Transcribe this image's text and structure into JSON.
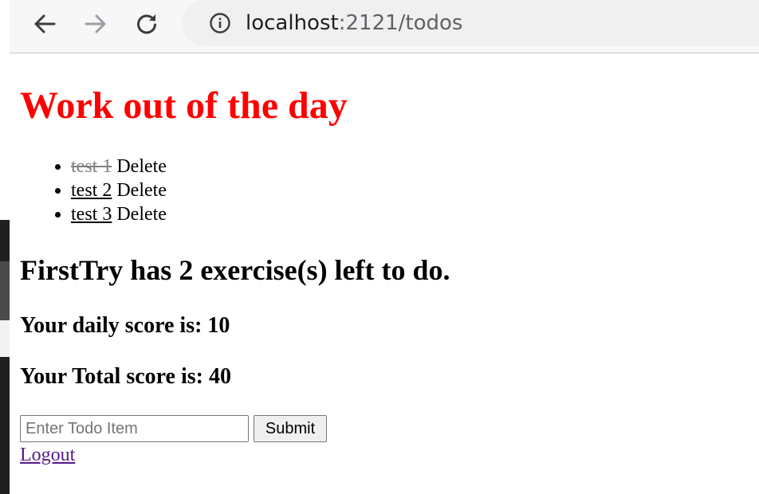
{
  "browser": {
    "url_host": "localhost",
    "url_path": ":2121/todos",
    "icons": {
      "back": "arrow-left-icon",
      "forward": "arrow-right-icon",
      "reload": "reload-icon",
      "site_info": "info-icon"
    }
  },
  "page": {
    "title": "Work out of the day",
    "title_color": "#ff0000",
    "todos": [
      {
        "text": "test 1",
        "completed": true,
        "delete_label": "Delete"
      },
      {
        "text": "test 2",
        "completed": false,
        "delete_label": "Delete"
      },
      {
        "text": "test 3",
        "completed": false,
        "delete_label": "Delete"
      }
    ],
    "status_text": "FirstTry has 2 exercise(s) left to do.",
    "daily_score_text": "Your daily score is: 10",
    "total_score_text": "Your Total score is: 40",
    "form": {
      "input_placeholder": "Enter Todo Item",
      "input_value": "",
      "submit_label": "Submit"
    },
    "logout_label": "Logout"
  }
}
